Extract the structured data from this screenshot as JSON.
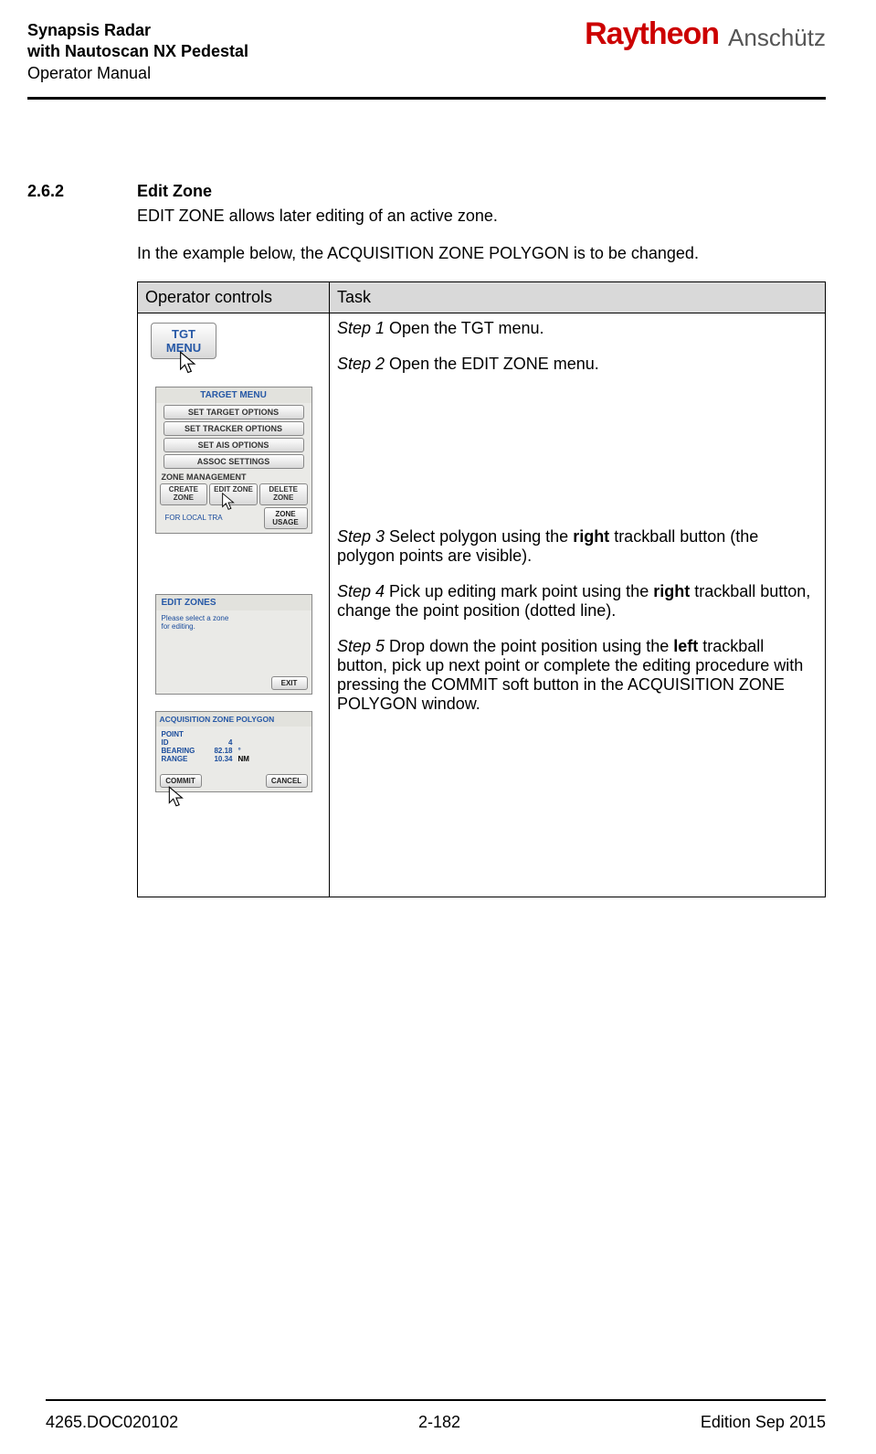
{
  "header": {
    "line1": "Synapsis Radar",
    "line2": "with Nautoscan NX Pedestal",
    "line3": "Operator Manual",
    "brand1": "Raytheon",
    "brand2": "Anschütz"
  },
  "section": {
    "number": "2.6.2",
    "title": "Edit Zone",
    "intro": "EDIT ZONE allows later editing of an active zone.",
    "example": "In the example below, the ACQUISITION ZONE POLYGON is to be changed."
  },
  "table": {
    "col1": "Operator controls",
    "col2": "Task",
    "step1_label": "Step 1",
    "step1_text": " Open the TGT menu.",
    "step2_label": "Step 2",
    "step2_text": " Open the EDIT ZONE menu.",
    "step3_label": "Step 3",
    "step3_a": " Select polygon using the ",
    "step3_bold": "right",
    "step3_b": " trackball button (the polygon points are visible).",
    "step4_label": "Step 4",
    "step4_a": " Pick up editing mark point using the ",
    "step4_bold": "right",
    "step4_b": " trackball button, change the point position (dotted line).",
    "step5_label": "Step 5",
    "step5_a": " Drop down the point position using the ",
    "step5_bold": "left",
    "step5_b": " trackball button, pick up next point or complete the editing procedure with pressing the COMMIT soft button in the ACQUISITION ZONE POLYGON window."
  },
  "ui": {
    "tgt_btn_l1": "TGT",
    "tgt_btn_l2": "MENU",
    "target_menu_title": "TARGET MENU",
    "btn_set_target": "SET TARGET OPTIONS",
    "btn_set_tracker": "SET TRACKER OPTIONS",
    "btn_set_ais": "SET AIS OPTIONS",
    "btn_assoc": "ASSOC SETTINGS",
    "zone_mgmt": "ZONE MANAGEMENT",
    "btn_create": "CREATE ZONE",
    "btn_edit": "EDIT ZONE",
    "btn_delete": "DELETE ZONE",
    "note_local": "FOR LOCAL TRA",
    "btn_usage": "ZONE USAGE",
    "edit_zones_title": "EDIT ZONES",
    "edit_zones_msg1": "Please select a zone",
    "edit_zones_msg2": "for editing.",
    "btn_exit": "EXIT",
    "acq_title": "ACQUISITION ZONE POLYGON",
    "point_lbl": "POINT",
    "id_lbl": "ID",
    "id_val": "4",
    "brg_lbl": "BEARING",
    "brg_val": "82.18",
    "deg": "°",
    "rng_lbl": "RANGE",
    "rng_val": "10.34",
    "nm": "NM",
    "btn_commit": "COMMIT",
    "btn_cancel": "CANCEL"
  },
  "footer": {
    "left": "4265.DOC020102",
    "center": "2-182",
    "right": "Edition Sep 2015"
  }
}
